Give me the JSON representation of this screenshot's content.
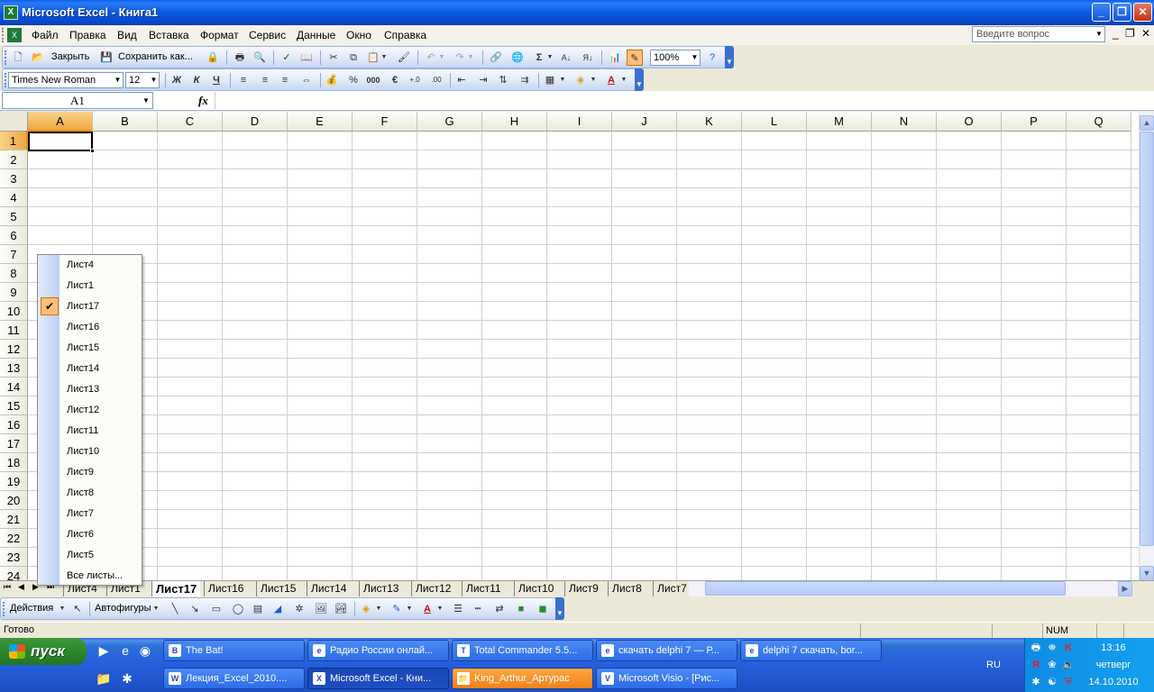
{
  "window": {
    "title": "Microsoft Excel - Книга1",
    "app_icon": "excel-icon"
  },
  "menubar": {
    "items": [
      "Файл",
      "Правка",
      "Вид",
      "Вставка",
      "Формат",
      "Сервис",
      "Данные",
      "Окно",
      "Справка"
    ],
    "ask_placeholder": "Введите вопрос"
  },
  "toolbar_standard": {
    "close_label": "Закрыть",
    "save_as_label": "Сохранить как...",
    "zoom": "100%"
  },
  "toolbar_format": {
    "font": "Times New Roman",
    "size": "12",
    "bold": "Ж",
    "italic": "К",
    "underline": "Ч",
    "percent": "%",
    "thousands": "000",
    "euro": "€"
  },
  "formula": {
    "namebox": "A1",
    "fx": "fx",
    "value": ""
  },
  "grid": {
    "columns": [
      "A",
      "B",
      "C",
      "D",
      "E",
      "F",
      "G",
      "H",
      "I",
      "J",
      "K",
      "L",
      "M",
      "N",
      "O",
      "P",
      "Q"
    ],
    "rows": [
      "1",
      "2",
      "3",
      "4",
      "5",
      "6",
      "7",
      "8",
      "9",
      "10",
      "11",
      "12",
      "13",
      "14",
      "15",
      "16",
      "17",
      "18",
      "19",
      "20",
      "21",
      "22",
      "23",
      "24"
    ],
    "active_cell": "A1"
  },
  "sheet_popup": {
    "items": [
      "Лист4",
      "Лист1",
      "Лист17",
      "Лист16",
      "Лист15",
      "Лист14",
      "Лист13",
      "Лист12",
      "Лист11",
      "Лист10",
      "Лист9",
      "Лист8",
      "Лист7",
      "Лист6",
      "Лист5"
    ],
    "checked": "Лист17",
    "all_sheets": "Все листы..."
  },
  "sheet_tabs": {
    "items": [
      "Лист4",
      "Лист1",
      "Лист17",
      "Лист16",
      "Лист15",
      "Лист14",
      "Лист13",
      "Лист12",
      "Лист11",
      "Лист10",
      "Лист9",
      "Лист8",
      "Лист7"
    ],
    "active": "Лист17"
  },
  "drawbar": {
    "actions_label": "Действия",
    "autoshapes_label": "Автофигуры"
  },
  "status": {
    "text": "Готово",
    "num": "NUM"
  },
  "taskbar": {
    "start_label": "пуск",
    "row1": [
      "The Bat!",
      "Радио России онлай...",
      "Total Commander 5.5...",
      "скачать delphi 7 — Р...",
      "delphi 7 скачать, bor..."
    ],
    "row2": [
      "Лекция_Excel_2010....",
      "Microsoft Excel - Кни...",
      "King_Arthur_Артурас",
      "Microsoft Visio - [Рис..."
    ],
    "lang": "RU",
    "time": "13:16",
    "day": "четверг",
    "date": "14.10.2010"
  }
}
